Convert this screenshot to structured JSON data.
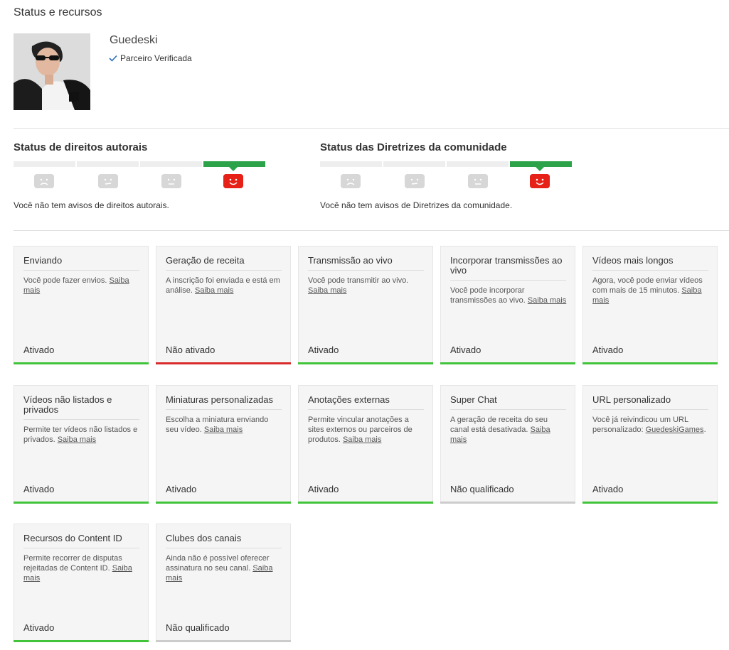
{
  "page": {
    "title": "Status e recursos"
  },
  "channel": {
    "name": "Guedeski",
    "verified_label": "Parceiro Verificada"
  },
  "copyright": {
    "title": "Status de direitos autorais",
    "note": "Você não tem avisos de direitos autorais.",
    "strikes": 0
  },
  "community": {
    "title": "Status das Diretrizes da comunidade",
    "note": "Você não tem avisos de Diretrizes da comunidade.",
    "strikes": 0
  },
  "colors": {
    "enabled": "#41c43a",
    "disabled": "#d92b2b",
    "not_eligible": "#cccccc",
    "good_standing": "#2ca349"
  },
  "features": [
    {
      "title": "Enviando",
      "desc": "Você pode fazer envios.",
      "link": "Saiba mais",
      "status": "Ativado"
    },
    {
      "title": "Geração de receita",
      "desc": "A inscrição foi enviada e está em análise.",
      "link": "Saiba mais",
      "status": "Não ativado"
    },
    {
      "title": "Transmissão ao vivo",
      "desc": "Você pode transmitir ao vivo.",
      "link": "Saiba mais",
      "status": "Ativado"
    },
    {
      "title": "Incorporar transmissões ao vivo",
      "desc": "Você pode incorporar transmissões ao vivo.",
      "link": "Saiba mais",
      "status": "Ativado"
    },
    {
      "title": "Vídeos mais longos",
      "desc": "Agora, você pode enviar vídeos com mais de 15 minutos.",
      "link": "Saiba mais",
      "status": "Ativado"
    },
    {
      "title": "Vídeos não listados e privados",
      "desc": "Permite ter vídeos não listados e privados.",
      "link": "Saiba mais",
      "status": "Ativado"
    },
    {
      "title": "Miniaturas personalizadas",
      "desc": "Escolha a miniatura enviando seu vídeo.",
      "link": "Saiba mais",
      "status": "Ativado"
    },
    {
      "title": "Anotações externas",
      "desc": "Permite vincular anotações a sites externos ou parceiros de produtos.",
      "link": "Saiba mais",
      "status": "Ativado"
    },
    {
      "title": "Super Chat",
      "desc": "A geração de receita do seu canal está desativada.",
      "link": "Saiba mais",
      "status": "Não qualificado"
    },
    {
      "title": "URL personalizado",
      "desc": "Você já reivindicou um URL personalizado:",
      "link": "GuedeskiGames",
      "suffix": ".",
      "status": "Ativado"
    },
    {
      "title": "Recursos do Content ID",
      "desc": "Permite recorrer de disputas rejeitadas de Content ID.",
      "link": "Saiba mais",
      "status": "Ativado"
    },
    {
      "title": "Clubes dos canais",
      "desc": "Ainda não é possível oferecer assinatura no seu canal.",
      "link": "Saiba mais",
      "status": "Não qualificado"
    }
  ]
}
